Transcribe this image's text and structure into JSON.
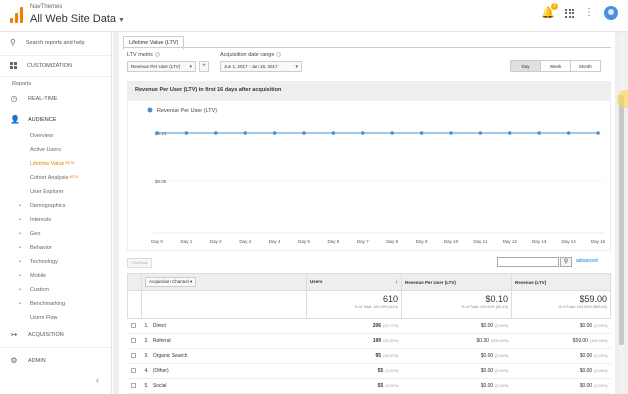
{
  "header": {
    "account_small": "NavThemes",
    "account_big": "All Web Site Data",
    "notification_count": "1"
  },
  "sidebar": {
    "search_label": "Search reports and help",
    "customization": "CUSTOMIZATION",
    "reports": "Reports",
    "realtime": "REAL-TIME",
    "audience": "AUDIENCE",
    "audience_items": [
      "Overview",
      "Active Users",
      "Lifetime Value",
      "Cohort Analysis",
      "User Explorer",
      "Demographics",
      "Interests",
      "Geo",
      "Behavior",
      "Technology",
      "Mobile",
      "Custom",
      "Benchmarking",
      "Users Flow"
    ],
    "beta": "BETA",
    "acquisition": "ACQUISITION",
    "admin": "ADMIN"
  },
  "report": {
    "tab": "Lifetime Value (LTV)",
    "ltv_metric_label": "LTV metric",
    "ltv_metric_value": "Revenue Per User (LTV)",
    "acq_range_label": "Acquisition date range",
    "acq_range_value": "Jun 1, 2017 - Jun 16, 2017",
    "granularity": [
      "Day",
      "Week",
      "Month"
    ],
    "chart_title": "Revenue Per User (LTV) in first 16 days after acquisition"
  },
  "chart_data": {
    "type": "line",
    "series": [
      {
        "name": "Revenue Per User (LTV)",
        "values": [
          0.1,
          0.1,
          0.1,
          0.1,
          0.1,
          0.1,
          0.1,
          0.1,
          0.1,
          0.1,
          0.1,
          0.1,
          0.1,
          0.1,
          0.1,
          0.1
        ]
      }
    ],
    "categories": [
      "Day 0",
      "Day 1",
      "Day 2",
      "Day 3",
      "Day 4",
      "Day 5",
      "Day 6",
      "Day 7",
      "Day 8",
      "Day 9",
      "Day 10",
      "Day 11",
      "Day 12",
      "Day 13",
      "Day 14",
      "Day 15"
    ],
    "y_ticks": [
      "$0.10",
      "$0.05"
    ],
    "ylim": [
      0,
      0.1
    ],
    "color": "#4d8fd4"
  },
  "table": {
    "plot_rows": "Plot Rows",
    "advanced": "advanced",
    "col_dimension": "Acquisition Channel",
    "col_users": "Users",
    "col_rpu": "Revenue Per User (LTV)",
    "col_rev": "Revenue (LTV)",
    "totals": {
      "users": "610",
      "users_sub": "% of Total: 100.00% (610)",
      "rpu": "$0.10",
      "rpu_sub": "% of Total: 100.00% ($0.10)",
      "rev": "$59.00",
      "rev_sub": "% of Total: 100.00% ($59.00)"
    },
    "rows": [
      {
        "idx": "1.",
        "channel": "Direct",
        "users": "206",
        "users_pct": "(33.77%)",
        "rpu": "$0.00",
        "rpu_pct": "(0.00%)",
        "rev": "$0.00",
        "rev_pct": "(0.00%)"
      },
      {
        "idx": "2.",
        "channel": "Referral",
        "users": "199",
        "users_pct": "(32.62%)",
        "rpu": "$0.30",
        "rpu_pct": "(306.53%)",
        "rev": "$59.00",
        "rev_pct": "(100.00%)"
      },
      {
        "idx": "3.",
        "channel": "Organic Search",
        "users": "95",
        "users_pct": "(15.57%)",
        "rpu": "$0.00",
        "rpu_pct": "(0.00%)",
        "rev": "$0.00",
        "rev_pct": "(0.00%)"
      },
      {
        "idx": "4.",
        "channel": "(Other)",
        "users": "55",
        "users_pct": "(9.02%)",
        "rpu": "$0.00",
        "rpu_pct": "(0.00%)",
        "rev": "$0.00",
        "rev_pct": "(0.00%)"
      },
      {
        "idx": "5.",
        "channel": "Social",
        "users": "55",
        "users_pct": "(9.02%)",
        "rpu": "$0.00",
        "rpu_pct": "(0.00%)",
        "rev": "$0.00",
        "rev_pct": "(0.00%)"
      }
    ]
  }
}
